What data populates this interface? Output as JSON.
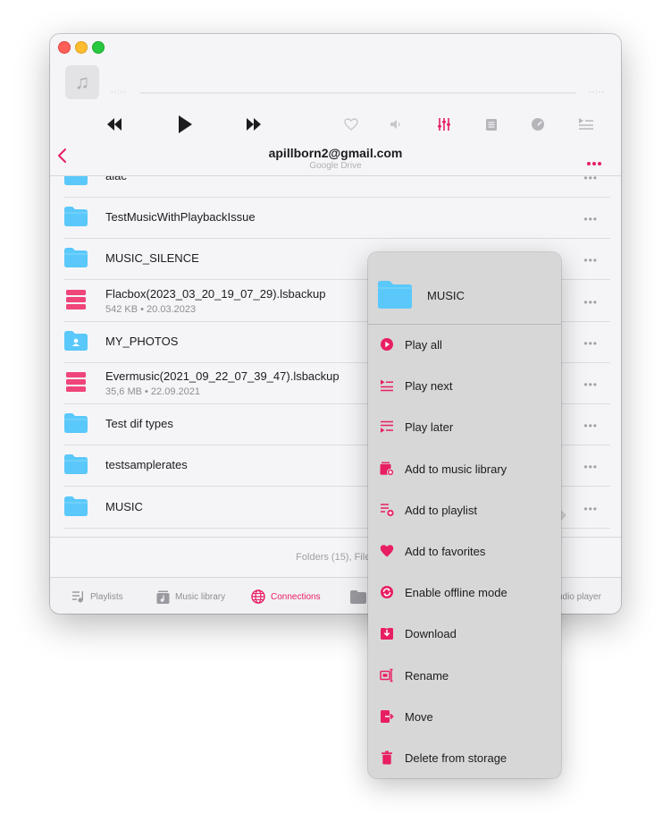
{
  "player": {
    "elapsed": "--:--",
    "remaining": "--:--"
  },
  "header": {
    "title": "apillborn2@gmail.com",
    "subtitle": "Google Drive"
  },
  "files": [
    {
      "name": "alac",
      "meta": "",
      "icon": "folder-icon"
    },
    {
      "name": "TestMusicWithPlaybackIssue",
      "meta": "",
      "icon": "folder-icon"
    },
    {
      "name": "MUSIC_SILENCE",
      "meta": "",
      "icon": "folder-icon"
    },
    {
      "name": "Flacbox(2023_03_20_19_07_29).lsbackup",
      "meta": "542 KB • 20.03.2023",
      "icon": "backup-file-icon"
    },
    {
      "name": "MY_PHOTOS",
      "meta": "",
      "icon": "shared-folder-icon"
    },
    {
      "name": "Evermusic(2021_09_22_07_39_47).lsbackup",
      "meta": "35,6 MB • 22.09.2021",
      "icon": "backup-file-icon"
    },
    {
      "name": "Test dif types",
      "meta": "",
      "icon": "folder-icon"
    },
    {
      "name": "testsamplerates",
      "meta": "",
      "icon": "folder-icon"
    },
    {
      "name": "MUSIC",
      "meta": "",
      "icon": "folder-icon"
    }
  ],
  "footer": {
    "summary": "Folders (15), Files"
  },
  "tabs": [
    {
      "label": "Playlists",
      "icon": "playlists-icon"
    },
    {
      "label": "Music library",
      "icon": "music-library-icon"
    },
    {
      "label": "Connections",
      "icon": "globe-icon"
    },
    {
      "label": "udio player",
      "icon": "folder-icon"
    }
  ],
  "context_menu": {
    "title": "MUSIC",
    "items": [
      {
        "label": "Play all",
        "icon": "play-circle-icon"
      },
      {
        "label": "Play next",
        "icon": "play-next-icon"
      },
      {
        "label": "Play later",
        "icon": "play-later-icon"
      },
      {
        "label": "Add to music library",
        "icon": "add-library-icon"
      },
      {
        "label": "Add to playlist",
        "icon": "add-playlist-icon"
      },
      {
        "label": "Add to favorites",
        "icon": "heart-icon"
      },
      {
        "label": "Enable offline mode",
        "icon": "offline-icon"
      },
      {
        "label": "Download",
        "icon": "download-icon"
      },
      {
        "label": "Rename",
        "icon": "rename-icon"
      },
      {
        "label": "Move",
        "icon": "move-icon"
      },
      {
        "label": "Delete from storage",
        "icon": "trash-icon"
      }
    ]
  },
  "colors": {
    "accent": "#e81e63",
    "folder": "#5ac8fa",
    "backup_file": "#f0457a"
  }
}
